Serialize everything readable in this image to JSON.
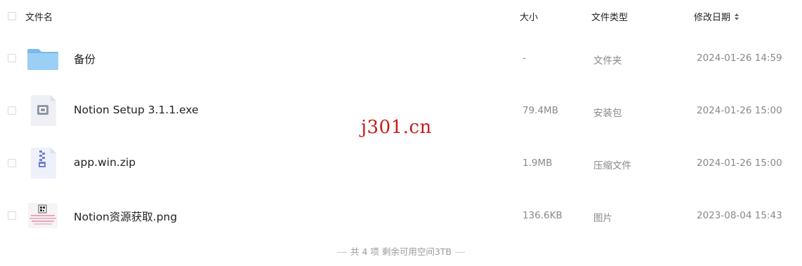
{
  "header": {
    "name_label": "文件名",
    "size_label": "大小",
    "type_label": "文件类型",
    "modified_label": "修改日期"
  },
  "files": [
    {
      "name": "备份",
      "size": "-",
      "type": "文件夹",
      "date": "2024-01-26 14:59",
      "icon": "folder-icon"
    },
    {
      "name": "Notion Setup 3.1.1.exe",
      "size": "79.4MB",
      "type": "安装包",
      "date": "2024-01-26 15:00",
      "icon": "exe-file-icon"
    },
    {
      "name": "app.win.zip",
      "size": "1.9MB",
      "type": "压缩文件",
      "date": "2024-01-26 15:00",
      "icon": "zip-file-icon"
    },
    {
      "name": "Notion资源获取.png",
      "size": "136.6KB",
      "type": "图片",
      "date": "2023-08-04 15:43",
      "icon": "image-thumbnail-icon"
    }
  ],
  "footer": {
    "summary": "共 4 项  剩余可用空间3TB"
  },
  "watermark": {
    "text": "j301.cn"
  },
  "colors": {
    "folder": "#8cc4f2",
    "watermark": "#c91b1b",
    "muted_text": "#888888"
  }
}
